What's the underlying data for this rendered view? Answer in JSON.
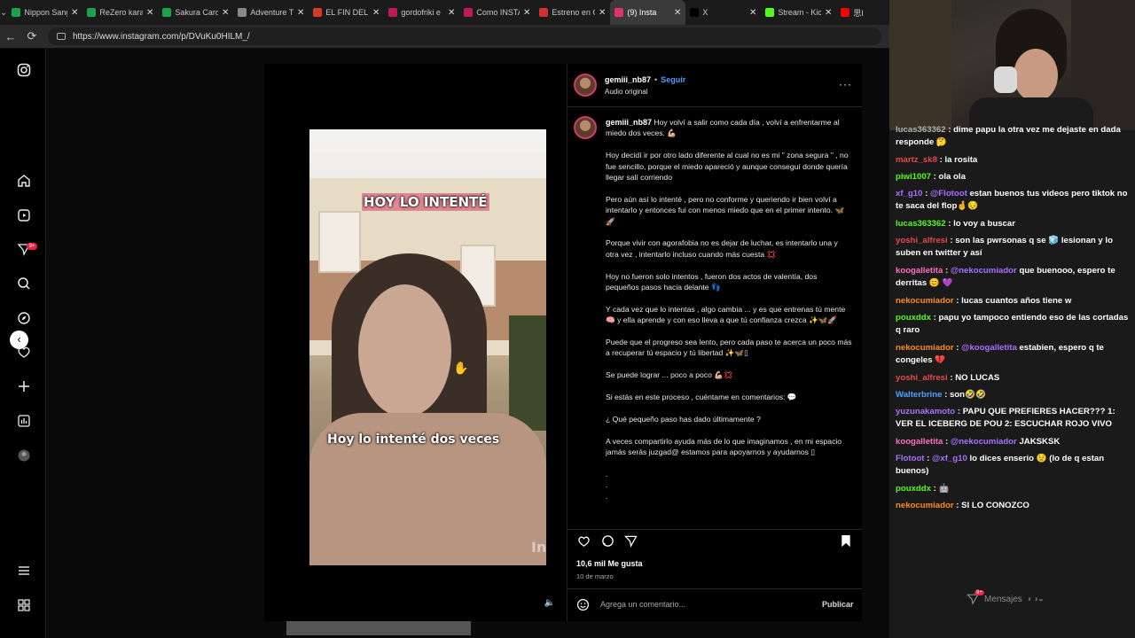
{
  "browser": {
    "tabs": [
      {
        "label": "Nippon Sang",
        "color": "#1aa34a"
      },
      {
        "label": "ReZero kara",
        "color": "#1aa34a"
      },
      {
        "label": "Sakura Card",
        "color": "#1aa34a"
      },
      {
        "label": "Adventure Ti",
        "color": "#888888"
      },
      {
        "label": "EL FIN DEL P",
        "color": "#d83a2a"
      },
      {
        "label": "gordofriki e",
        "color": "#c2185b"
      },
      {
        "label": "Como INSTA",
        "color": "#c2185b"
      },
      {
        "label": "Estreno en C",
        "color": "#d32f2f"
      },
      {
        "label": "(9) Insta",
        "color": "#e1306c",
        "active": true
      },
      {
        "label": "X",
        "color": "#000000"
      },
      {
        "label": "Stream - Kick",
        "color": "#53fc18"
      },
      {
        "label": "思I",
        "color": "#ff0000"
      }
    ],
    "url": "https://www.instagram.com/p/DVuKu0HILM_/"
  },
  "sidebar": {
    "badge": "9+"
  },
  "video": {
    "caption_top": "HOY LO INTENTÉ",
    "caption_bottom": "Hoy lo intenté dos veces",
    "watermark": "InSh"
  },
  "post": {
    "username": "gemiii_nb87",
    "follow": "Seguir",
    "audio": "Audio original",
    "caption_user": "gemiii_nb87",
    "caption_first": "Hoy volví a salir como cada día , volví a enfrentarme al miedo dos veces. 💪🏼",
    "paragraphs": [
      "Hoy decidí ir por otro lado diferente al cual no es mi \" zona segura \" , no fue sencillo, porque el miedo apareció y aunque conseguí donde quería llegar salí corriendo",
      "Pero aún así lo intenté , pero no conforme y queriendo ir bien volví a intentarlo y entonces fui con menos miedo que en el primer intento. 🦋🚀",
      "Porque vivir con agorafobia no es dejar de luchar, es intentarlo una y otra vez , intentarlo incluso cuando más cuesta 💢",
      "Hoy no fueron solo intentos , fueron dos actos de valentía, dos pequeños pasos hacia delante 👣",
      "Y cada vez que lo intentas , algo cambia ... y es que entrenas tú mente 🧠 y ella aprende y con eso lleva a que tú confianza crezca ✨🦋🚀",
      "Puede que el progreso sea lento, pero cada paso te acerca un poco más a recuperar tú espacio y tú libertad ✨🦋▯",
      "Se puede lograr ... poco a poco 💪🏼💢",
      "Si estás en este proceso , cuéntame en comentarios: 💬",
      "¿ Qué pequeño paso has dado últimamente ?",
      "A veces compartirlo ayuda más de lo que imaginamos , en mi espacio jamás serás juzgad@ estamos para apoyarnos y ayudarnos ▯"
    ],
    "dots": [
      ".",
      ".",
      "."
    ],
    "likes": "10,6 mil Me gusta",
    "date": "10 de marzo",
    "comment_placeholder": "Agrega un comentario...",
    "publish": "Publicar"
  },
  "chat": {
    "messages": [
      {
        "user": "lucas363362",
        "color": "#b0b0b0",
        "text": "dime papu la otra vez me dejaste en dada responde 🤔"
      },
      {
        "user": "martz_sk8",
        "color": "#e5484d",
        "text": "la rosita"
      },
      {
        "user": "piwi1007",
        "color": "#53fc18",
        "text": "ola ola"
      },
      {
        "user": "xf_g10",
        "color": "#a970ff",
        "mention": "@Flotoot",
        "text": "estan buenos tus videos pero tiktok no te saca del flop🤞😔"
      },
      {
        "user": "lucas363362",
        "color": "#53fc18",
        "text": "lo voy a buscar"
      },
      {
        "user": "yoshi_alfresi",
        "color": "#e5484d",
        "text": "son las pwrsonas q se 🧊 lesionan y lo suben en twitter y así"
      },
      {
        "user": "koogalletita",
        "color": "#ff6ec7",
        "mention": "@nekocumiador",
        "text": "que buenooo, espero te derritas 😊 💜"
      },
      {
        "user": "nekocumiador",
        "color": "#ff8c1a",
        "text": "lucas cuantos años tiene w"
      },
      {
        "user": "pouxddx",
        "color": "#53fc18",
        "text": "papu yo tampoco entiendo eso de las cortadas q raro"
      },
      {
        "user": "nekocumiador",
        "color": "#ff8c1a",
        "mention": "@koogalletita",
        "text": "estabien, espero q te congeles 💔"
      },
      {
        "user": "yoshi_alfresi",
        "color": "#e5484d",
        "text": "NO LUCAS"
      },
      {
        "user": "Walterbrine",
        "color": "#4aa3ff",
        "text": "son🤣🤣"
      },
      {
        "user": "yuzunakamoto",
        "color": "#a970ff",
        "text": "PAPU QUE PREFIERES HACER??? 1: VER EL ICEBERG DE POU 2: ESCUCHAR ROJO VIVO"
      },
      {
        "user": "koogalletita",
        "color": "#ff6ec7",
        "mention": "@nekocumiador",
        "text": "JAKSKSK"
      },
      {
        "user": "Flotoot",
        "color": "#a970ff",
        "mention": "@xf_g10",
        "text": "lo dices enserio 😟 (lo de q estan buenos)"
      },
      {
        "user": "pouxddx",
        "color": "#53fc18",
        "text": "🤖"
      },
      {
        "user": "nekocumiador",
        "color": "#ff8c1a",
        "text": "SI LO CONOZCO"
      }
    ],
    "footer_badge": "9+",
    "footer_label": "Mensajes"
  }
}
